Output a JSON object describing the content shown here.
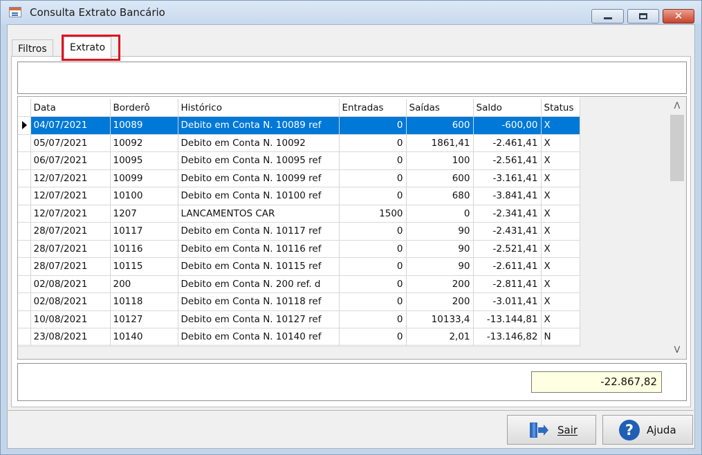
{
  "window": {
    "title": "Consulta Extrato Bancário",
    "close_glyph": "✕"
  },
  "tabs": [
    {
      "label": "Filtros"
    },
    {
      "label": "Extrato"
    }
  ],
  "grid": {
    "columns": [
      "Data",
      "Borderô",
      "Histórico",
      "Entradas",
      "Saídas",
      "Saldo",
      "Status"
    ],
    "selected_row": 0,
    "rows": [
      [
        "04/07/2021",
        "10089",
        "Debito em Conta N. 10089 ref",
        "0",
        "600",
        "-600,00",
        "X"
      ],
      [
        "05/07/2021",
        "10092",
        "Debito em Conta N. 10092",
        "0",
        "1861,41",
        "-2.461,41",
        "X"
      ],
      [
        "06/07/2021",
        "10095",
        "Debito em Conta N. 10095 ref",
        "0",
        "100",
        "-2.561,41",
        "X"
      ],
      [
        "12/07/2021",
        "10099",
        "Debito em Conta N. 10099 ref",
        "0",
        "600",
        "-3.161,41",
        "X"
      ],
      [
        "12/07/2021",
        "10100",
        "Debito em Conta N. 10100 ref",
        "0",
        "680",
        "-3.841,41",
        "X"
      ],
      [
        "12/07/2021",
        "1207",
        "LANCAMENTOS CAR",
        "1500",
        "0",
        "-2.341,41",
        "X"
      ],
      [
        "28/07/2021",
        "10117",
        "Debito em Conta N. 10117 ref",
        "0",
        "90",
        "-2.431,41",
        "X"
      ],
      [
        "28/07/2021",
        "10116",
        "Debito em Conta N. 10116 ref",
        "0",
        "90",
        "-2.521,41",
        "X"
      ],
      [
        "28/07/2021",
        "10115",
        "Debito em Conta N. 10115 ref",
        "0",
        "90",
        "-2.611,41",
        "X"
      ],
      [
        "02/08/2021",
        "200",
        "Debito em Conta N. 200 ref. d",
        "0",
        "200",
        "-2.811,41",
        "X"
      ],
      [
        "02/08/2021",
        "10118",
        "Debito em Conta N. 10118 ref",
        "0",
        "200",
        "-3.011,41",
        "X"
      ],
      [
        "10/08/2021",
        "10127",
        "Debito em Conta N. 10127 ref",
        "0",
        "10133,4",
        "-13.144,81",
        "X"
      ],
      [
        "23/08/2021",
        "10140",
        "Debito em Conta N. 10140 ref",
        "0",
        "2,01",
        "-13.146,82",
        "N"
      ]
    ]
  },
  "total": {
    "value": "-22.867,82"
  },
  "buttons": {
    "sair": {
      "label": "Sair",
      "icon": "exit-door-icon"
    },
    "ajuda": {
      "label": "Ajuda",
      "icon": "help-icon",
      "glyph": "?"
    }
  },
  "scrollbar": {
    "up_glyph": "ᐱ",
    "down_glyph": "ᐯ"
  },
  "colors": {
    "selection": "#0078d7",
    "highlight_box": "#e0101d",
    "total_bg": "#ffffe1"
  }
}
